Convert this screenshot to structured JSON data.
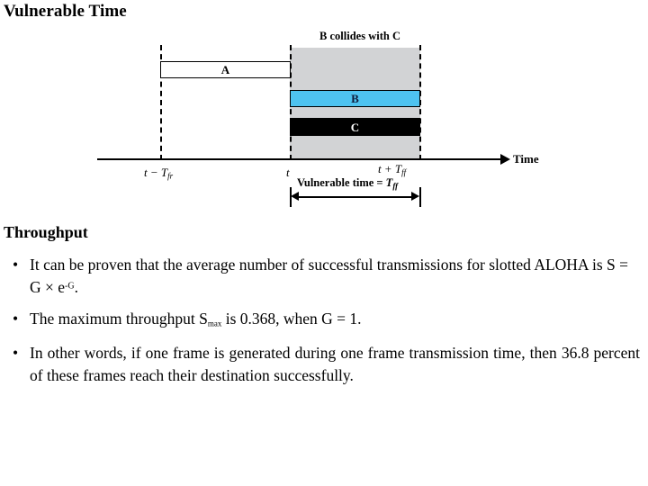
{
  "slide": {
    "title": "Vulnerable Time"
  },
  "diagram": {
    "name": "vulnerable-time-diagram",
    "collision_caption": "B collides with C",
    "frames": [
      {
        "id": "A",
        "label": "A",
        "fill": "#ffffff",
        "text_color": "#000000"
      },
      {
        "id": "B",
        "label": "B",
        "fill": "#4ec3f0",
        "text_color": "#101b3a"
      },
      {
        "id": "C",
        "label": "C",
        "fill": "#000000",
        "text_color": "#ffffff"
      }
    ],
    "band_color": "#d2d3d5",
    "axis": {
      "label": "Time",
      "ticks": [
        {
          "id": "t-minus-tfr",
          "main": "t − T",
          "sub": "fr"
        },
        {
          "id": "t",
          "main": "t",
          "sub": ""
        },
        {
          "id": "t-plus-tfr",
          "main": "t + T",
          "sub": "ff"
        }
      ]
    },
    "measure": {
      "label_prefix": "Vulnerable time = ",
      "label_symbol": "T",
      "label_subscript": "ff"
    }
  },
  "content": {
    "heading": "Throughput",
    "bullet_marker": "•",
    "bullets": [
      {
        "id": "bullet-average-transmissions",
        "parts": [
          {
            "type": "text",
            "value": "It can be proven that the average number of successful transmissions for slotted ALOHA is S = G × e"
          },
          {
            "type": "sup",
            "value": "-G"
          },
          {
            "type": "text",
            "value": "."
          }
        ]
      },
      {
        "id": "bullet-max-throughput",
        "parts": [
          {
            "type": "text",
            "value": "The maximum throughput S"
          },
          {
            "type": "sub",
            "value": "max"
          },
          {
            "type": "text",
            "value": " is 0.368, when G = 1."
          }
        ]
      },
      {
        "id": "bullet-in-other-words",
        "parts": [
          {
            "type": "text",
            "value": "In other words, if one frame is generated during one frame transmission time, then 36.8 percent of these frames reach their destination successfully."
          }
        ]
      }
    ]
  }
}
